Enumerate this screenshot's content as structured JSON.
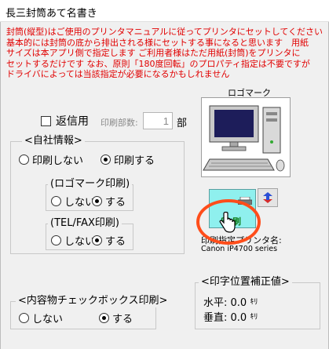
{
  "window": {
    "title": "長三封筒あて名書き"
  },
  "notice": {
    "text": "封筒(縦型)はご使用のプリンタマニュアルに従ってプリンタにセットしてください\n基本的には封筒の底から排出される様にセットする事になると思います　用紙\nサイズは本アプリ側で指定します  ご利用者様はただ用紙(封筒)をプリンタに\nセットするだけです  なお、原則「180度回転」のプロパティ指定は不要ですが\nドライバによっては当該指定が必要になるかもしれません"
  },
  "return_mail": {
    "label": "返信用",
    "checked": false,
    "copies_label": "印刷部数:",
    "copies_value": "1",
    "copies_unit": "部"
  },
  "company_info": {
    "title": "<自社情報>",
    "options": [
      "印刷しない",
      "印刷する"
    ],
    "selected": "印刷する",
    "logo_print": {
      "title": "(ロゴマーク印刷)",
      "options": [
        "しない",
        "する"
      ],
      "selected": "する"
    },
    "tel_fax_print": {
      "title": "(TEL/FAX印刷)",
      "options": [
        "しない",
        "する"
      ],
      "selected": "する"
    }
  },
  "contents_checkbox": {
    "title": "<内容物チェックボックス印刷>",
    "options": [
      "しない",
      "する"
    ],
    "selected": "する"
  },
  "logo": {
    "label": "ロゴマーク",
    "image": "computer-icon"
  },
  "print_button": {
    "label": "印刷",
    "icon": "printer-icon"
  },
  "refresh_button": {
    "icon": "refresh-icon"
  },
  "printer": {
    "label": "印刷指定プリンタ名:",
    "name": "Canon iP4700 series"
  },
  "print_offset": {
    "title": "<印字位置補正値>",
    "horizontal_label": "水平:",
    "horizontal_value": "0.0",
    "vertical_label": "垂直:",
    "vertical_value": "0.0",
    "unit": "ｷﾘ"
  },
  "colors": {
    "notice_text": "#e10000",
    "print_button_bg": "#8ff0ee",
    "highlight": "#ff4d1a"
  }
}
